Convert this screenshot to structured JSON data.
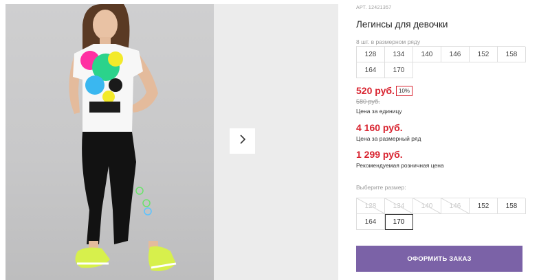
{
  "product": {
    "article": "АРТ. 12421357",
    "title": "Легинсы для девочки",
    "pack_note": "8 шт. в размерном ряду",
    "pack_sizes": [
      "128",
      "134",
      "140",
      "146",
      "152",
      "158",
      "164",
      "170"
    ],
    "price_unit": "520 руб.",
    "discount_badge": "10%",
    "price_old": "580 руб.",
    "price_unit_label": "Цена за единицу",
    "price_pack": "4 160 руб.",
    "price_pack_label": "Цена за размерный ряд",
    "price_rrp": "1 299 руб.",
    "price_rrp_label": "Рекомендуемая розничная цена"
  },
  "size_picker": {
    "label": "Выберите размер:",
    "sizes": [
      {
        "label": "128",
        "available": false
      },
      {
        "label": "134",
        "available": false
      },
      {
        "label": "140",
        "available": false
      },
      {
        "label": "146",
        "available": false
      },
      {
        "label": "152",
        "available": true
      },
      {
        "label": "158",
        "available": true
      },
      {
        "label": "164",
        "available": true
      },
      {
        "label": "170",
        "available": true,
        "selected": true
      }
    ]
  },
  "order_button": "ОФОРМИТЬ ЗАКАЗ",
  "gallery": {
    "next_icon": "chevron-right-icon",
    "main_image": "girl-in-tshirt-and-leggings-photo"
  },
  "colors": {
    "price_red": "#d8232f",
    "order_purple": "#7b62a7"
  }
}
